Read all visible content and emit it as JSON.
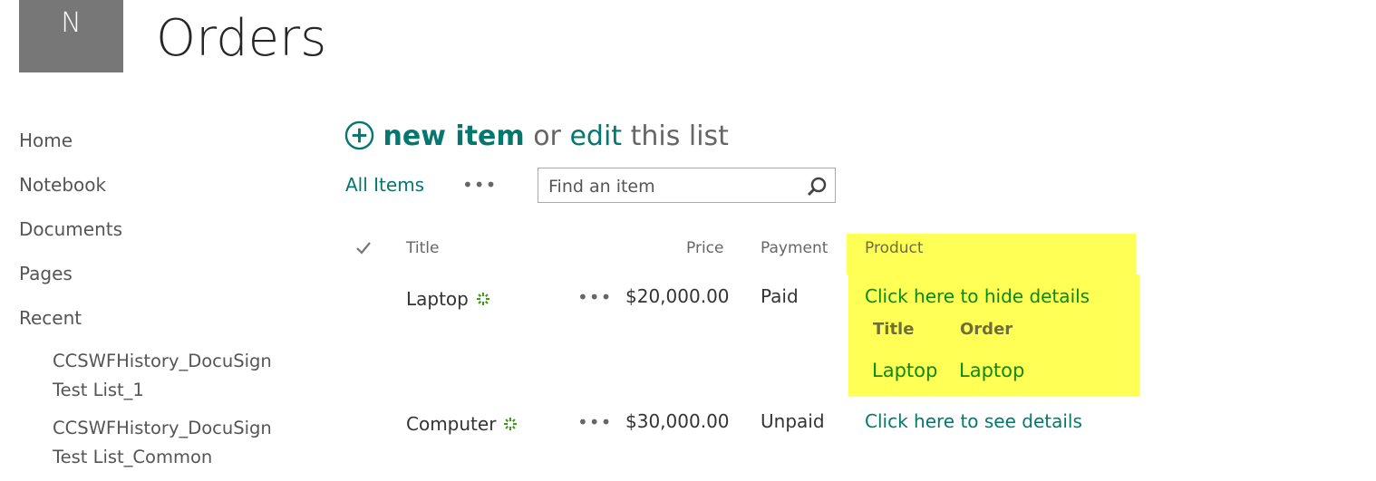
{
  "site": {
    "logo_letter": "N",
    "title": "Orders"
  },
  "nav": {
    "items": [
      {
        "label": "Home"
      },
      {
        "label": "Notebook"
      },
      {
        "label": "Documents"
      },
      {
        "label": "Pages"
      },
      {
        "label": "Recent"
      }
    ],
    "recent": [
      {
        "label": "CCSWFHistory_DocuSign Test List_1"
      },
      {
        "label": "CCSWFHistory_DocuSign Test List_Common"
      }
    ]
  },
  "command": {
    "new_item": "new item",
    "or": "or",
    "edit": "edit",
    "this_list": "this list",
    "plus_icon": "circle-plus-icon",
    "accent": "#05776e"
  },
  "views": {
    "current": "All Items",
    "more": "•••"
  },
  "search": {
    "placeholder": "Find an item",
    "value": ""
  },
  "table": {
    "headers": {
      "check": "✓",
      "title": "Title",
      "price": "Price",
      "payment": "Payment",
      "product": "Product"
    },
    "rows": [
      {
        "title": "Laptop",
        "new_badge": "new-item-icon",
        "menu": "•••",
        "price": "$20,000.00",
        "payment": "Paid",
        "product_link": "Click here to hide details",
        "expanded": true,
        "details": {
          "headers": [
            "Title",
            "Order"
          ],
          "values": [
            "Laptop",
            "Laptop"
          ]
        }
      },
      {
        "title": "Computer",
        "new_badge": "new-item-icon",
        "menu": "•••",
        "price": "$30,000.00",
        "payment": "Unpaid",
        "product_link": "Click here to see details",
        "expanded": false
      }
    ],
    "highlight_color": "#ffff55"
  }
}
